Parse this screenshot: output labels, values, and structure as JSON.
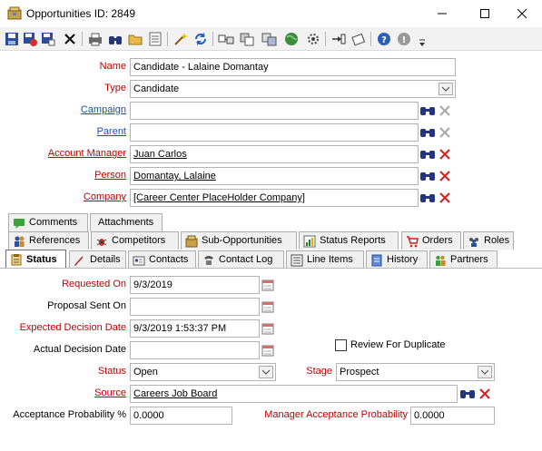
{
  "window": {
    "title": "Opportunities ID: 2849",
    "minimize_glyph": "—",
    "maximize_glyph": "☐",
    "close_glyph": "✕"
  },
  "toolbar": {
    "buttons": [
      "save-icon",
      "save-close-icon",
      "save-new-icon",
      "delete-icon",
      "print-icon",
      "find-icon",
      "open-folder-icon",
      "notes-icon",
      "wizard-icon",
      "refresh-icon",
      "link-icon",
      "copy-icon",
      "move-icon",
      "web-icon",
      "settings-icon",
      "import-icon",
      "edit-icon",
      "help-icon",
      "info-icon",
      "more-icon"
    ]
  },
  "fields": {
    "name": {
      "label": "Name",
      "value": "Candidate - Lalaine Domantay"
    },
    "type": {
      "label": "Type",
      "value": "Candidate"
    },
    "campaign": {
      "label": "Campaign",
      "value": ""
    },
    "parent": {
      "label": "Parent",
      "value": ""
    },
    "account_manager": {
      "label": "Account Manager",
      "value": "Juan Carlos"
    },
    "person": {
      "label": "Person",
      "value": "Domantay, Lalaine"
    },
    "company": {
      "label": "Company",
      "value": "[Career Center PlaceHolder Company]"
    }
  },
  "tabs": {
    "row1": [
      {
        "label": "Comments",
        "icon": "comment-icon"
      },
      {
        "label": "Attachments",
        "icon": ""
      }
    ],
    "row2": [
      {
        "label": "References",
        "icon": "people-icon"
      },
      {
        "label": "Competitors",
        "icon": "bug-icon"
      },
      {
        "label": "Sub-Opportunities",
        "icon": "box-icon"
      },
      {
        "label": "Status Reports",
        "icon": "report-icon"
      },
      {
        "label": "Orders",
        "icon": "cart-icon"
      },
      {
        "label": "Roles",
        "icon": "group-icon"
      }
    ],
    "row3": [
      {
        "label": "Status",
        "icon": "clipboard-icon",
        "active": true
      },
      {
        "label": "Details",
        "icon": "pen-icon"
      },
      {
        "label": "Contacts",
        "icon": "card-icon"
      },
      {
        "label": "Contact Log",
        "icon": "phone-icon"
      },
      {
        "label": "Line Items",
        "icon": "list-icon"
      },
      {
        "label": "History",
        "icon": "history-icon"
      },
      {
        "label": "Partners",
        "icon": "partners-icon"
      }
    ]
  },
  "status": {
    "requested_on": {
      "label": "Requested On",
      "value": "9/3/2019"
    },
    "proposal_sent_on": {
      "label": "Proposal Sent On",
      "value": ""
    },
    "expected_decision_date": {
      "label": "Expected Decision Date",
      "value": "9/3/2019 1:53:37 PM"
    },
    "actual_decision_date": {
      "label": "Actual Decision Date",
      "value": ""
    },
    "review_for_duplicate": {
      "label": "Review For Duplicate",
      "checked": false
    },
    "status": {
      "label": "Status",
      "value": "Open"
    },
    "stage": {
      "label": "Stage",
      "value": "Prospect"
    },
    "source": {
      "label": "Source",
      "value": "Careers Job Board"
    },
    "acceptance_probability": {
      "label": "Acceptance Probability %",
      "value": "0.0000"
    },
    "manager_acceptance_probability": {
      "label": "Manager Acceptance Probability",
      "value": "0.0000"
    }
  },
  "colors": {
    "required_label": "#c00000",
    "link_label": "#1a4fa8",
    "panel_bg": "#ffffff"
  }
}
